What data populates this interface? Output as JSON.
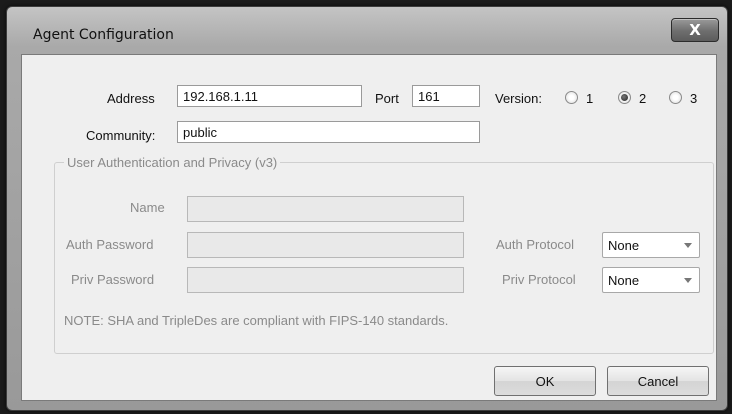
{
  "window": {
    "title": "Agent Configuration",
    "close_glyph": "X"
  },
  "agent": {
    "address_label": "Address",
    "address_value": "192.168.1.11",
    "port_label": "Port",
    "port_value": "161",
    "version_label": "Version:",
    "versions": [
      {
        "label": "1",
        "selected": false
      },
      {
        "label": "2",
        "selected": true
      },
      {
        "label": "3",
        "selected": false
      }
    ],
    "community_label": "Community:",
    "community_value": "public"
  },
  "auth_group": {
    "title": "User Authentication and Privacy (v3)",
    "name_label": "Name",
    "name_value": "",
    "auth_password_label": "Auth Password",
    "auth_password_value": "",
    "priv_password_label": "Priv Password",
    "priv_password_value": "",
    "auth_protocol_label": "Auth Protocol",
    "auth_protocol_value": "None",
    "priv_protocol_label": "Priv Protocol",
    "priv_protocol_value": "None",
    "note": "NOTE: SHA and TripleDes are compliant with FIPS-140 standards."
  },
  "buttons": {
    "ok": "OK",
    "cancel": "Cancel"
  },
  "icons": {
    "close": "close-icon",
    "dropdown": "chevron-down-icon"
  }
}
